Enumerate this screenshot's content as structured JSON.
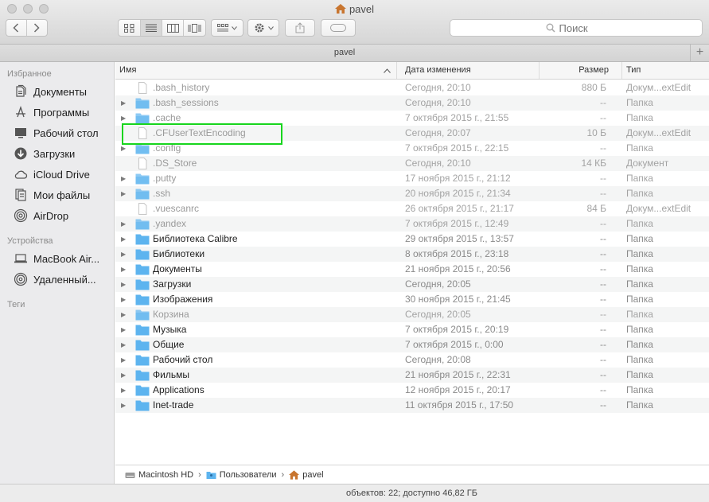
{
  "window": {
    "title": "pavel"
  },
  "toolbar": {
    "search_placeholder": "Поиск"
  },
  "tab": {
    "label": "pavel",
    "plus": "+"
  },
  "sidebar": {
    "sections": [
      {
        "heading": "Избранное",
        "items": [
          {
            "label": "Документы",
            "icon": "documents-icon"
          },
          {
            "label": "Программы",
            "icon": "applications-icon"
          },
          {
            "label": "Рабочий стол",
            "icon": "desktop-icon"
          },
          {
            "label": "Загрузки",
            "icon": "downloads-icon"
          },
          {
            "label": "iCloud Drive",
            "icon": "cloud-icon"
          },
          {
            "label": "Мои файлы",
            "icon": "all-files-icon"
          },
          {
            "label": "AirDrop",
            "icon": "airdrop-icon"
          }
        ]
      },
      {
        "heading": "Устройства",
        "items": [
          {
            "label": "MacBook Air...",
            "icon": "laptop-icon"
          },
          {
            "label": "Удаленный...",
            "icon": "disc-icon"
          }
        ]
      },
      {
        "heading": "Теги",
        "items": []
      }
    ]
  },
  "columns": {
    "name": "Имя",
    "date": "Дата изменения",
    "size": "Размер",
    "kind": "Тип"
  },
  "files": [
    {
      "name": ".bash_history",
      "date": "Сегодня, 20:10",
      "size": "880 Б",
      "kind": "Докум...extEdit",
      "folder": false,
      "dim": true,
      "expandable": false
    },
    {
      "name": ".bash_sessions",
      "date": "Сегодня, 20:10",
      "size": "--",
      "kind": "Папка",
      "folder": true,
      "dim": true,
      "expandable": true
    },
    {
      "name": ".cache",
      "date": "7 октября 2015 г., 21:55",
      "size": "--",
      "kind": "Папка",
      "folder": true,
      "dim": true,
      "expandable": true
    },
    {
      "name": ".CFUserTextEncoding",
      "date": "Сегодня, 20:07",
      "size": "10 Б",
      "kind": "Докум...extEdit",
      "folder": false,
      "dim": true,
      "expandable": false
    },
    {
      "name": ".config",
      "date": "7 октября 2015 г., 22:15",
      "size": "--",
      "kind": "Папка",
      "folder": true,
      "dim": true,
      "expandable": true
    },
    {
      "name": ".DS_Store",
      "date": "Сегодня, 20:10",
      "size": "14 КБ",
      "kind": "Документ",
      "folder": false,
      "dim": true,
      "expandable": false
    },
    {
      "name": ".putty",
      "date": "17 ноября 2015 г., 21:12",
      "size": "--",
      "kind": "Папка",
      "folder": true,
      "dim": true,
      "expandable": true
    },
    {
      "name": ".ssh",
      "date": "20 ноября 2015 г., 21:34",
      "size": "--",
      "kind": "Папка",
      "folder": true,
      "dim": true,
      "expandable": true
    },
    {
      "name": ".vuescanrc",
      "date": "26 октября 2015 г., 21:17",
      "size": "84 Б",
      "kind": "Докум...extEdit",
      "folder": false,
      "dim": true,
      "expandable": false
    },
    {
      "name": ".yandex",
      "date": "7 октября 2015 г., 12:49",
      "size": "--",
      "kind": "Папка",
      "folder": true,
      "dim": true,
      "expandable": true
    },
    {
      "name": "Библиотека Calibre",
      "date": "29 октября 2015 г., 13:57",
      "size": "--",
      "kind": "Папка",
      "folder": true,
      "dim": false,
      "expandable": true
    },
    {
      "name": "Библиотеки",
      "date": "8 октября 2015 г., 23:18",
      "size": "--",
      "kind": "Папка",
      "folder": true,
      "dim": false,
      "expandable": true
    },
    {
      "name": "Документы",
      "date": "21 ноября 2015 г., 20:56",
      "size": "--",
      "kind": "Папка",
      "folder": true,
      "dim": false,
      "expandable": true
    },
    {
      "name": "Загрузки",
      "date": "Сегодня, 20:05",
      "size": "--",
      "kind": "Папка",
      "folder": true,
      "dim": false,
      "expandable": true
    },
    {
      "name": "Изображения",
      "date": "30 ноября 2015 г., 21:45",
      "size": "--",
      "kind": "Папка",
      "folder": true,
      "dim": false,
      "expandable": true
    },
    {
      "name": "Корзина",
      "date": "Сегодня, 20:05",
      "size": "--",
      "kind": "Папка",
      "folder": true,
      "dim": true,
      "expandable": true
    },
    {
      "name": "Музыка",
      "date": "7 октября 2015 г., 20:19",
      "size": "--",
      "kind": "Папка",
      "folder": true,
      "dim": false,
      "expandable": true
    },
    {
      "name": "Общие",
      "date": "7 октября 2015 г., 0:00",
      "size": "--",
      "kind": "Папка",
      "folder": true,
      "dim": false,
      "expandable": true
    },
    {
      "name": "Рабочий стол",
      "date": "Сегодня, 20:08",
      "size": "--",
      "kind": "Папка",
      "folder": true,
      "dim": false,
      "expandable": true
    },
    {
      "name": "Фильмы",
      "date": "21 ноября 2015 г., 22:31",
      "size": "--",
      "kind": "Папка",
      "folder": true,
      "dim": false,
      "expandable": true
    },
    {
      "name": "Applications",
      "date": "12 ноября 2015 г., 20:17",
      "size": "--",
      "kind": "Папка",
      "folder": true,
      "dim": false,
      "expandable": true
    },
    {
      "name": "Inet-trade",
      "date": "11 октября 2015 г., 17:50",
      "size": "--",
      "kind": "Папка",
      "folder": true,
      "dim": false,
      "expandable": true
    }
  ],
  "path": [
    "Macintosh HD",
    "Пользователи",
    "pavel"
  ],
  "status": "объектов: 22; доступно 46,82 ГБ",
  "colors": {
    "folder": "#5db4ef",
    "highlight": "#18d51e",
    "sidebar_icon": "#555555"
  }
}
